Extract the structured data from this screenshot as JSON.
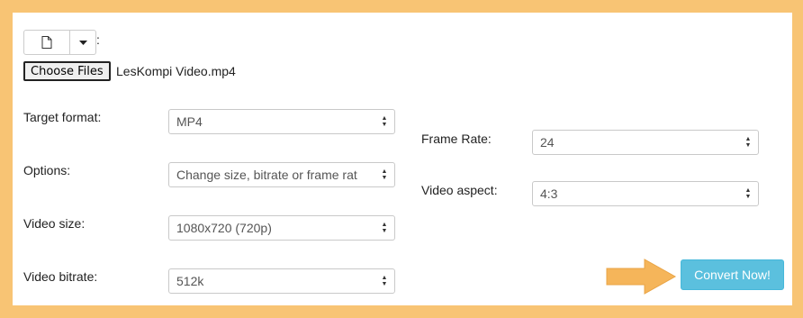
{
  "upload": {
    "colon": ":",
    "choose_label": "Choose Files",
    "file_name": "LesKompi Video.mp4"
  },
  "form": {
    "target_format": {
      "label": "Target format:",
      "value": "MP4"
    },
    "options": {
      "label": "Options:",
      "value": "Change size, bitrate or frame rat"
    },
    "video_size": {
      "label": "Video size:",
      "value": "1080x720 (720p)"
    },
    "video_bitrate": {
      "label": "Video bitrate:",
      "value": "512k"
    },
    "frame_rate": {
      "label": "Frame Rate:",
      "value": "24"
    },
    "video_aspect": {
      "label": "Video aspect:",
      "value": "4:3"
    }
  },
  "actions": {
    "convert_label": "Convert Now!"
  },
  "colors": {
    "frame": "#f8c474",
    "accent": "#5bc0de",
    "arrow": "#f5b55a"
  },
  "icons": [
    "file-icon",
    "caret-down-icon",
    "select-arrows-icon",
    "arrow-right-icon"
  ]
}
